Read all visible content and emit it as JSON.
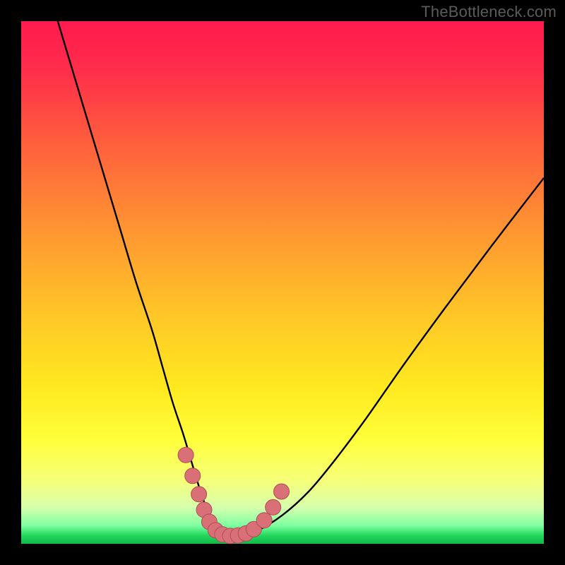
{
  "watermark": "TheBottleneck.com",
  "colors": {
    "frame": "#000000",
    "curve_stroke": "#000000",
    "marker_fill": "#d96f77",
    "marker_stroke": "#b24d55",
    "green_band": "#1fd65b"
  },
  "gradient_stops": [
    {
      "offset": 0.0,
      "color": "#ff1a4f"
    },
    {
      "offset": 0.1,
      "color": "#ff2f4a"
    },
    {
      "offset": 0.22,
      "color": "#ff5a3e"
    },
    {
      "offset": 0.38,
      "color": "#ff8f33"
    },
    {
      "offset": 0.55,
      "color": "#ffc328"
    },
    {
      "offset": 0.7,
      "color": "#ffe91f"
    },
    {
      "offset": 0.8,
      "color": "#ffff3a"
    },
    {
      "offset": 0.88,
      "color": "#f6ff7a"
    },
    {
      "offset": 0.93,
      "color": "#d7ffad"
    },
    {
      "offset": 0.965,
      "color": "#7effa0"
    },
    {
      "offset": 0.985,
      "color": "#1fd65b"
    },
    {
      "offset": 1.0,
      "color": "#12b74a"
    }
  ],
  "chart_data": {
    "type": "line",
    "title": "",
    "xlabel": "",
    "ylabel": "",
    "xlim": [
      0,
      100
    ],
    "ylim": [
      0,
      100
    ],
    "series": [
      {
        "name": "bottleneck-curve",
        "x": [
          7,
          10,
          13,
          16,
          19,
          22,
          25,
          27,
          29,
          31,
          32.5,
          34,
          35,
          36,
          37,
          38.5,
          40,
          42,
          45,
          50,
          55,
          60,
          66,
          73,
          81,
          90,
          100
        ],
        "y": [
          100,
          90,
          80,
          70,
          60,
          50,
          41,
          34,
          27,
          21,
          16,
          11,
          8,
          5.5,
          3.5,
          2.2,
          1.6,
          1.6,
          2.4,
          5.5,
          10,
          16,
          24,
          34,
          45,
          57,
          70
        ]
      }
    ],
    "markers": {
      "name": "highlight-dots",
      "points": [
        {
          "x": 31.5,
          "y": 17
        },
        {
          "x": 32.8,
          "y": 13
        },
        {
          "x": 34.0,
          "y": 9.5
        },
        {
          "x": 35.0,
          "y": 6.5
        },
        {
          "x": 36.0,
          "y": 4.2
        },
        {
          "x": 37.2,
          "y": 2.6
        },
        {
          "x": 38.5,
          "y": 1.8
        },
        {
          "x": 40.0,
          "y": 1.5
        },
        {
          "x": 41.5,
          "y": 1.6
        },
        {
          "x": 43.0,
          "y": 2.0
        },
        {
          "x": 44.5,
          "y": 2.8
        },
        {
          "x": 46.5,
          "y": 4.5
        },
        {
          "x": 48.2,
          "y": 7.0
        },
        {
          "x": 49.8,
          "y": 10.0
        }
      ]
    }
  }
}
